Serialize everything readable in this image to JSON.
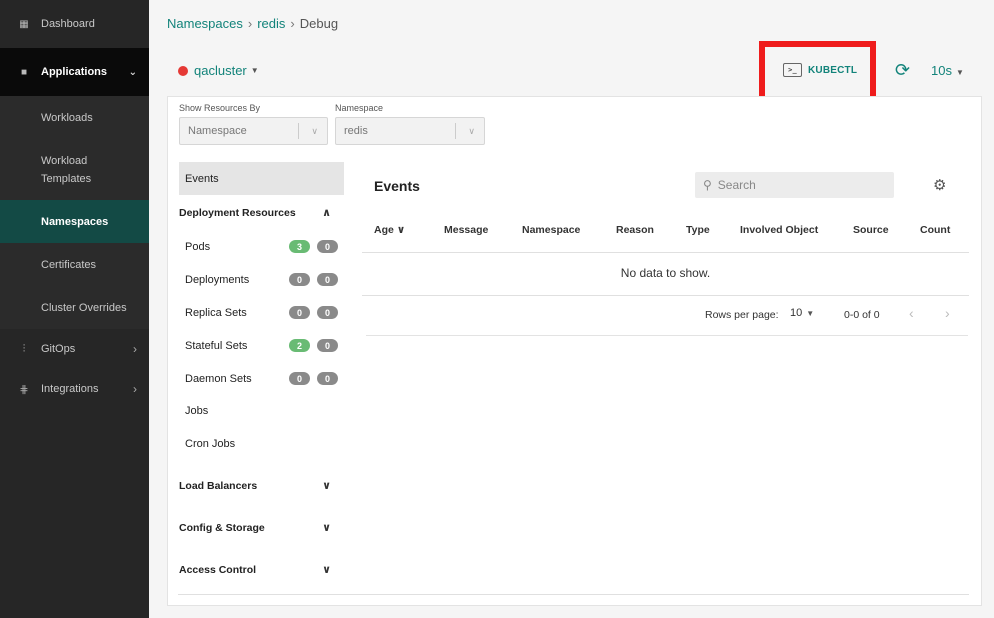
{
  "sidebar": {
    "dashboard": "Dashboard",
    "applications": "Applications",
    "sub_items": [
      "Workloads",
      "Workload Templates",
      "Namespaces",
      "Certificates",
      "Cluster Overrides"
    ],
    "gitops": "GitOps",
    "integrations": "Integrations"
  },
  "breadcrumb": {
    "root": "Namespaces",
    "name": "redis",
    "current": "Debug"
  },
  "header": {
    "cluster": "qacluster",
    "kubectl": "KUBECTL",
    "interval": "10s",
    "colors": {
      "accent": "#12837a",
      "cluster_status": "#e53935",
      "highlight": "#ef1c1c"
    }
  },
  "filters": {
    "show_by_label": "Show Resources By",
    "show_by_value": "Namespace",
    "namespace_label": "Namespace",
    "namespace_value": "redis"
  },
  "resources": {
    "events": "Events",
    "deployment_resources": "Deployment Resources",
    "items": [
      {
        "label": "Pods",
        "a": "3",
        "b": "0"
      },
      {
        "label": "Deployments",
        "a": "0",
        "b": "0"
      },
      {
        "label": "Replica Sets",
        "a": "0",
        "b": "0"
      },
      {
        "label": "Stateful Sets",
        "a": "2",
        "b": "0"
      },
      {
        "label": "Daemon Sets",
        "a": "0",
        "b": "0"
      },
      {
        "label": "Jobs"
      },
      {
        "label": "Cron Jobs"
      }
    ],
    "load_balancers": "Load Balancers",
    "config_storage": "Config & Storage",
    "access_control": "Access Control"
  },
  "events": {
    "title": "Events",
    "search_placeholder": "Search",
    "columns": [
      "Age",
      "Message",
      "Namespace",
      "Reason",
      "Type",
      "Involved Object",
      "Source",
      "Count"
    ],
    "empty": "No data to show.",
    "rows_per_page_label": "Rows per page:",
    "rows_per_page": "10",
    "range": "0-0 of 0"
  }
}
